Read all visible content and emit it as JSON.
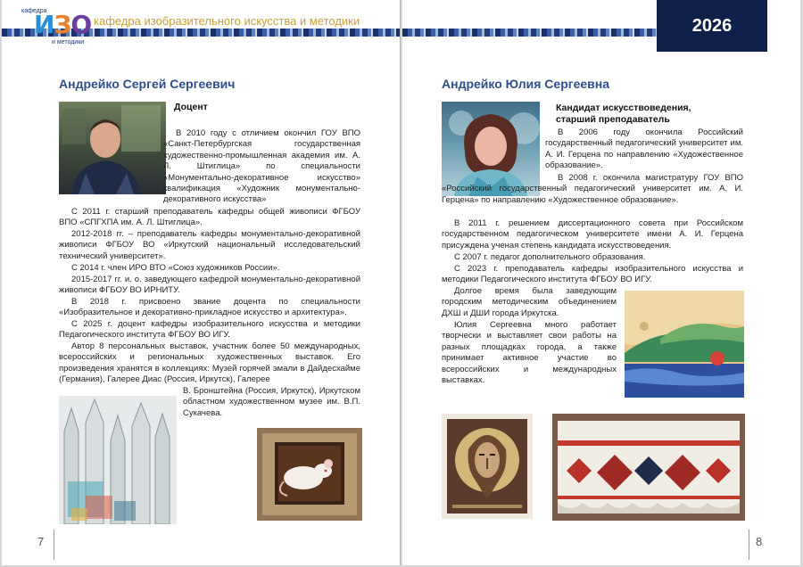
{
  "header": {
    "logo_small_top": "кафедра",
    "logo_big": [
      "И",
      "З",
      "О"
    ],
    "logo_small_bottom": "и методики",
    "department": "кафедра изобразительного искусства и методики",
    "year": "2026"
  },
  "left_page": {
    "name": "Андрейко Сергей Сергеевич",
    "role": "Доцент",
    "paragraphs": [
      "В 2010 году с отличием окончил ГОУ ВПО «Санкт-Петербургская государственная художественно-промышленная академия им. А. Л. Штиглица» по специальности «Монументально-декоративное искусство» квалификация «Художник монументально-декоративного искусства»",
      "С 2011 г. старший преподаватель кафедры общей живописи ФГБОУ ВПО «СПГХПА им. А. Л. Штиглица».",
      "2012-2018 гг. – преподаватель кафедры монументально-декоративной живописи ФГБОУ ВО «Иркутский национальный исследовательский технический университет».",
      "С 2014 г. член ИРО ВТО «Союз художников России».",
      "2015-2017 гг. и. о. заведующего кафедрой монументально-декоративной живописи ФГБОУ ВО ИРНИТУ.",
      "В 2018 г. присвоено звание доцента по специальности «Изобразительное и декоративно-прикладное искусство и архитектура».",
      "С 2025 г. доцент кафедры изобразительного искусства и методики Педагогического института ФГБОУ ВО ИГУ.",
      "Автор 8 персональных выставок, участник более 50 международных, всероссийских и региональных художественных выставок. Его произведения хранятся в коллекциях: Музей горячей эмали в Дайдесхайме (Германия), Галерее Диас (Россия, Иркутск), Галерее",
      "В. Бронштейна (Россия, Иркутск), Иркутском областном художественном музее им. В.П. Сукачева."
    ],
    "page_number": "7"
  },
  "right_page": {
    "name": "Андрейко Юлия Сергеевна",
    "role_lines": [
      "Кандидат искусствоведения,",
      "старший преподаватель"
    ],
    "paragraphs": [
      "В 2006 году окончила Российский государственный педагогический университет им. А. И. Герцена по направлению «Художественное образование».",
      "В 2008 г. окончила магистратуру ГОУ ВПО «Российский государственный педагогический университет им. А. И. Герцена» по направлению «Художественное образование».",
      "В 2011 г. решением диссертационного совета при Российском государственном педагогическом университете имени А. И. Герцена присуждена ученая степень кандидата искусствоведения.",
      "С 2007 г. педагог дополнительного образования.",
      "С 2023 г. преподаватель кафедры изобразительного искусства и методики Педагогического института ФГБОУ ВО ИГУ.",
      "Долгое время была заведующим городским методическим объединением ДХШ и ДШИ города Иркутска.",
      "Юлия Сергеевна много работает творчески и выставляет свои работы на разных площадках города, а также принимает активное участие во всероссийских и международных выставках."
    ],
    "page_number": "8"
  },
  "colors": {
    "name_blue": "#2f4e8a",
    "header_gold": "#c7a13a",
    "year_navy": "#0f2148"
  }
}
